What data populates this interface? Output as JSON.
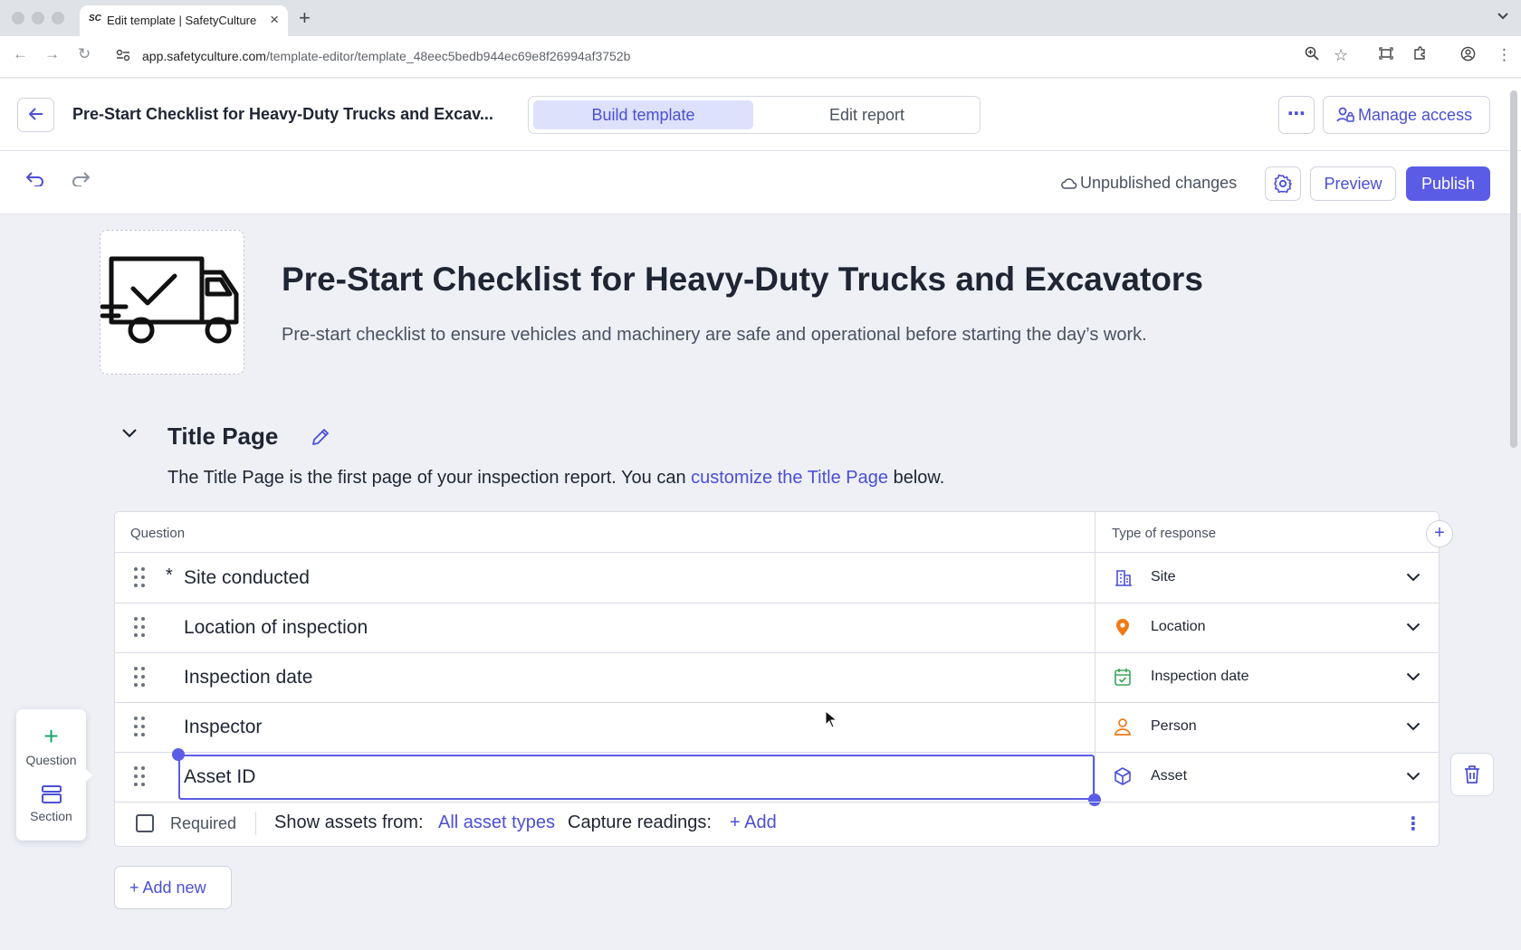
{
  "browser": {
    "tab_title": "Edit template | SafetyCulture",
    "tab_favicon": "SC",
    "url_domain": "app.safetyculture.com",
    "url_path": "/template-editor/template_48eec5bedb944ec69e8f26994af3752b"
  },
  "header": {
    "template_name": "Pre-Start Checklist for Heavy-Duty Trucks and Excav...",
    "mode_build": "Build template",
    "mode_edit": "Edit report",
    "more": "⋯",
    "manage_access": "Manage access"
  },
  "actionbar": {
    "status": "Unpublished changes",
    "preview": "Preview",
    "publish": "Publish"
  },
  "template": {
    "title": "Pre-Start Checklist for Heavy-Duty Trucks and Excavators",
    "description": "Pre-start checklist to ensure vehicles and machinery are safe and operational before starting the day’s work."
  },
  "section": {
    "title": "Title Page",
    "desc_before": "The Title Page is the first page of your inspection report. You can ",
    "desc_link": "customize the Title Page",
    "desc_after": " below."
  },
  "table": {
    "col_question": "Question",
    "col_response": "Type of response",
    "rows": [
      {
        "question": "Site conducted",
        "required_mark": "*",
        "response": "Site",
        "icon": "building-icon",
        "icon_color": "#4b4fd6"
      },
      {
        "question": "Location of inspection",
        "required_mark": "",
        "response": "Location",
        "icon": "map-pin-icon",
        "icon_color": "#f07a12"
      },
      {
        "question": "Inspection date",
        "required_mark": "",
        "response": "Inspection date",
        "icon": "calendar-check-icon",
        "icon_color": "#3aa65b"
      },
      {
        "question": "Inspector",
        "required_mark": "",
        "response": "Person",
        "icon": "person-icon",
        "icon_color": "#f07a12"
      },
      {
        "question": "Asset ID",
        "required_mark": "",
        "response": "Asset",
        "icon": "cube-icon",
        "icon_color": "#4b4fd6"
      }
    ],
    "options": {
      "required_label": "Required",
      "show_assets_label": "Show assets from:",
      "asset_types_link": "All asset types",
      "capture_label": "Capture readings:",
      "add_link": "+ Add"
    }
  },
  "add_new": "+ Add new",
  "palette": {
    "question_label": "Question",
    "section_label": "Section"
  },
  "colors": {
    "accent": "#5b5ce6",
    "link": "#4b4fd6",
    "mode_active_bg": "#dde1fb"
  }
}
